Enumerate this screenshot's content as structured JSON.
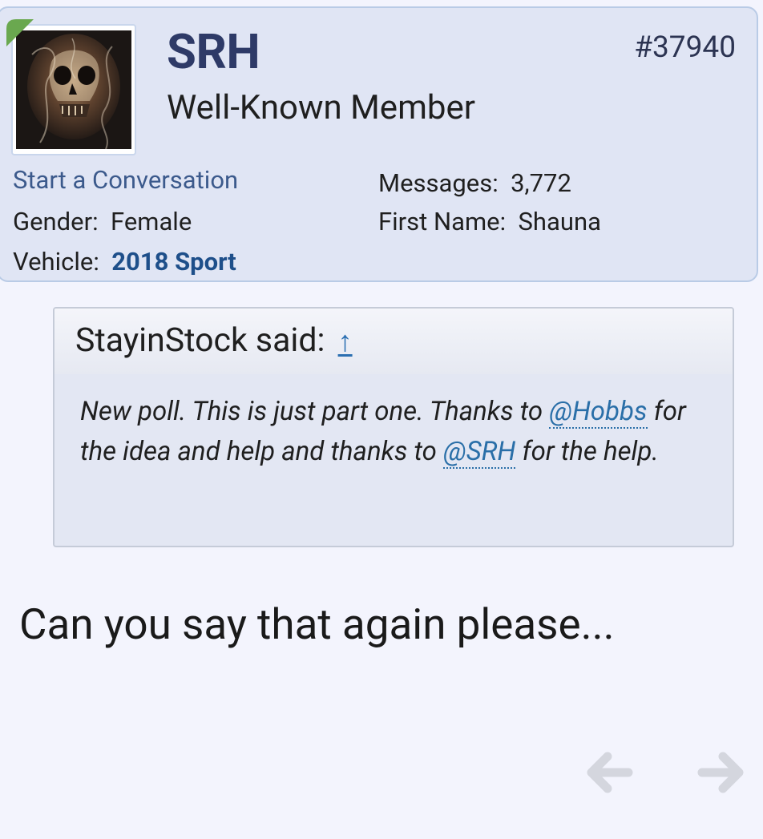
{
  "user": {
    "username": "SRH",
    "title": "Well-Known Member",
    "post_number": "#37940",
    "start_conversation": "Start a Conversation",
    "gender_label": "Gender:",
    "gender_value": "Female",
    "vehicle_label": "Vehicle:",
    "vehicle_value": "2018 Sport",
    "messages_label": "Messages:",
    "messages_value": "3,772",
    "first_name_label": "First Name:",
    "first_name_value": "Shauna",
    "online_color": "#6aa84f"
  },
  "quote": {
    "author_line": "StayinStock said:",
    "arrow_glyph": "↑",
    "body_1": "New poll. This is just part one. Thanks to",
    "mention_1": "@Hobbs",
    "body_2": "for the idea and help and thanks to",
    "mention_2": "@SRH",
    "body_3": "for the help."
  },
  "reply": {
    "text": "Can you say that again please..."
  },
  "navigation": {
    "prev_icon": "arrow-left-icon",
    "next_icon": "arrow-right-icon"
  }
}
